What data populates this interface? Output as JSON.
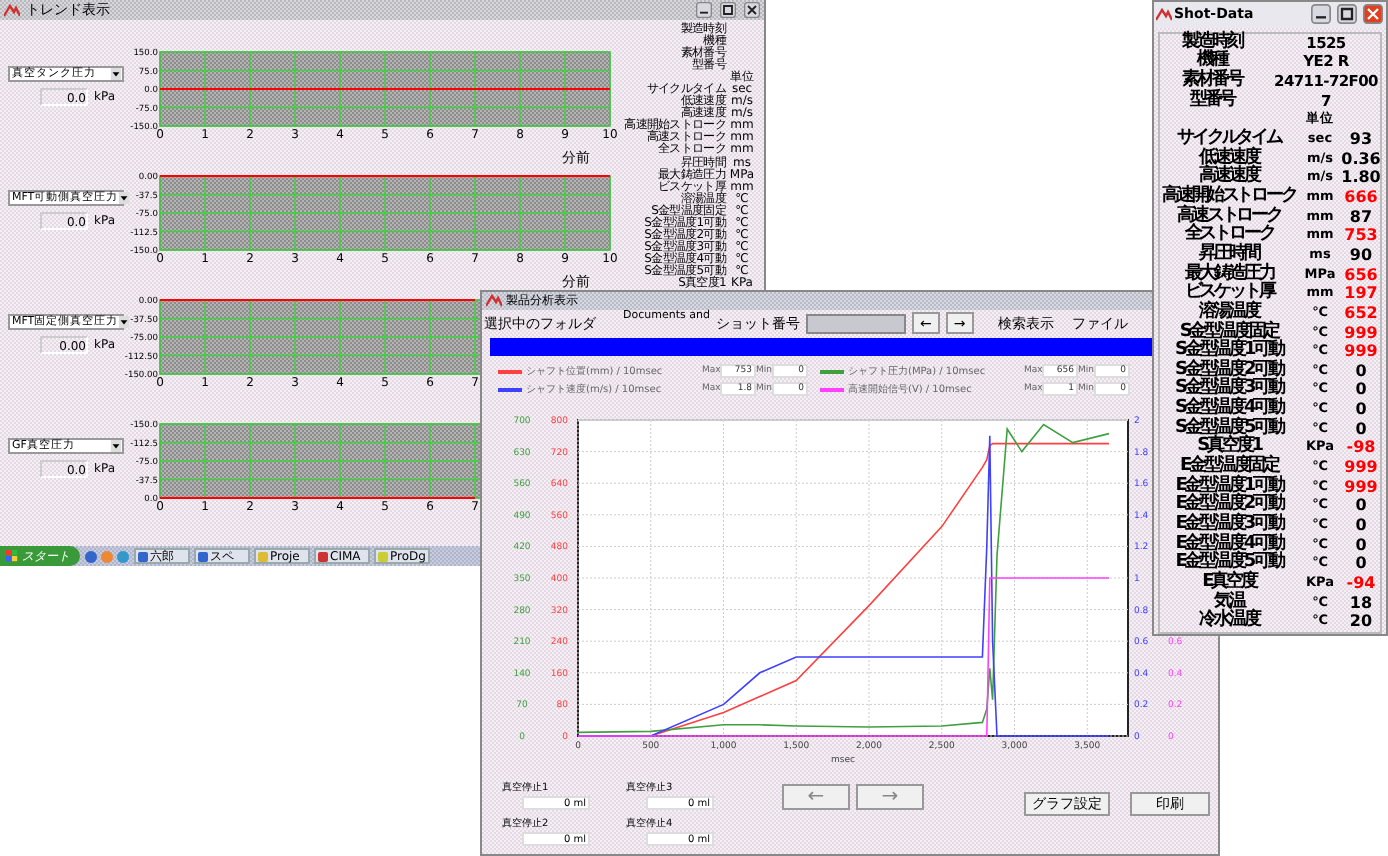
{
  "trend_window": {
    "title": "トレンド表示",
    "charts": [
      {
        "sensor": "真空タンク圧力",
        "value": "0.0",
        "unit": "kPa",
        "axis_caption": "分前",
        "chart_data": {
          "type": "line",
          "grid": true,
          "x": [
            0,
            10
          ],
          "xlim": [
            0,
            10
          ],
          "ylim": [
            -150,
            150
          ],
          "xticks": [
            0,
            1,
            2,
            3,
            4,
            5,
            6,
            7,
            8,
            9,
            10
          ],
          "yticks": [
            {
              "value": 150,
              "label": "150.0"
            },
            {
              "value": 75,
              "label": "75.0"
            },
            {
              "value": 0,
              "label": "0.0"
            },
            {
              "value": -75,
              "label": "-75.0"
            },
            {
              "value": -150,
              "label": "-150.0"
            }
          ],
          "series": [
            {
              "color": "#ff0000",
              "values": [
                0,
                0
              ]
            }
          ]
        }
      },
      {
        "sensor": "MFT可動側真空圧力",
        "value": "0.0",
        "unit": "kPa",
        "axis_caption": "分前",
        "chart_data": {
          "type": "line",
          "grid": true,
          "x": [
            0,
            10
          ],
          "xlim": [
            0,
            10
          ],
          "ylim": [
            -150,
            0
          ],
          "xticks": [
            0,
            1,
            2,
            3,
            4,
            5,
            6,
            7,
            8,
            9,
            10
          ],
          "yticks": [
            {
              "value": 0,
              "label": "0.00"
            },
            {
              "value": -37.5,
              "label": "-37.5"
            },
            {
              "value": -75,
              "label": "-75.0"
            },
            {
              "value": -112.5,
              "label": "-112.5"
            },
            {
              "value": -150,
              "label": "-150.0"
            }
          ],
          "series": [
            {
              "color": "#ff0000",
              "values": [
                0,
                0
              ]
            }
          ]
        }
      },
      {
        "sensor": "MFT固定側真空圧力",
        "value": "0.00",
        "unit": "kPa",
        "chart_data": {
          "type": "line",
          "grid": true,
          "x": [
            0,
            7
          ],
          "xlim": [
            0,
            10
          ],
          "ylim": [
            -150,
            0
          ],
          "xticks": [
            0,
            1,
            2,
            3,
            4,
            5,
            6,
            7
          ],
          "yticks": [
            {
              "value": 0,
              "label": "0.00"
            },
            {
              "value": -37.5,
              "label": "-37.50"
            },
            {
              "value": -75,
              "label": "-75.00"
            },
            {
              "value": -112.5,
              "label": "-112.50"
            },
            {
              "value": -150,
              "label": "-150.00"
            }
          ],
          "series": [
            {
              "color": "#ff0000",
              "values": [
                0,
                0
              ]
            }
          ]
        }
      },
      {
        "sensor": "GF真空圧力",
        "value": "0.0",
        "unit": "kPa",
        "chart_data": {
          "type": "line",
          "grid": true,
          "x": [
            0,
            7
          ],
          "xlim": [
            0,
            10
          ],
          "ylim": [
            0,
            -150
          ],
          "xticks": [
            0,
            1,
            2,
            3,
            4,
            5,
            6,
            7
          ],
          "yticks": [
            {
              "value": -150,
              "label": "-150.0"
            },
            {
              "value": -112.5,
              "label": "-112.5"
            },
            {
              "value": -75,
              "label": "-75.0"
            },
            {
              "value": -37.5,
              "label": "-37.5"
            },
            {
              "value": 0,
              "label": "0.0"
            }
          ],
          "series": [
            {
              "color": "#ff0000",
              "values": [
                0,
                0
              ]
            }
          ]
        }
      }
    ],
    "summary_items": [
      {
        "label": "製造時刻"
      },
      {
        "label": "機種"
      },
      {
        "label": "素材番号"
      },
      {
        "label": "型番号"
      },
      {
        "unit": "単位"
      },
      {
        "label": "サイクルタイム",
        "unit": "sec"
      },
      {
        "label": "低速速度",
        "unit": "m/s"
      },
      {
        "label": "高速速度",
        "unit": "m/s"
      },
      {
        "label": "高速開始ストローク",
        "unit": "mm"
      },
      {
        "label": "高速ストローク",
        "unit": "mm"
      },
      {
        "label": "全ストローク",
        "unit": "mm"
      },
      {
        "label": "昇圧時間",
        "unit": "ms"
      },
      {
        "label": "最大鋳造圧力",
        "unit": "MPa"
      },
      {
        "label": "ビスケット厚",
        "unit": "mm"
      },
      {
        "label": "溶湯温度",
        "unit": "℃"
      },
      {
        "label": "S金型温度固定",
        "unit": "℃"
      },
      {
        "label": "S金型温度1可動",
        "unit": "℃"
      },
      {
        "label": "S金型温度2可動",
        "unit": "℃"
      },
      {
        "label": "S金型温度3可動",
        "unit": "℃"
      },
      {
        "label": "S金型温度4可動",
        "unit": "℃"
      },
      {
        "label": "S金型温度5可動",
        "unit": "℃"
      },
      {
        "label": "S真空度1",
        "unit": "KPa"
      }
    ]
  },
  "taskbar": {
    "start": "スタート",
    "tasks": [
      "六郎",
      "スペ",
      "Proje",
      "CIMA",
      "ProDg"
    ]
  },
  "analysis_window": {
    "title": "製品分析表示",
    "progress": {
      "level": 1
    },
    "folder_label": "選択中のフォルダ",
    "folder_path": "Documents and",
    "shot_label": "ショット番号",
    "prev": "←",
    "next": "→",
    "search": "検索表示",
    "file": "ファイル",
    "legend": [
      {
        "name": "シャフト位置(mm) / 10msec",
        "color": "#ff4040",
        "max_label": "Max",
        "max": "753",
        "min_label": "Min",
        "min": "0"
      },
      {
        "name": "シャフト圧力(MPa) / 10msec",
        "color": "#40a040",
        "max_label": "Max",
        "max": "656",
        "min_label": "Min",
        "min": "0"
      },
      {
        "name": "シャフト速度(m/s) / 10msec",
        "color": "#4040ff",
        "max_label": "Max",
        "max": "1.8",
        "min_label": "Min",
        "min": "0"
      },
      {
        "name": "高速開始信号(V) / 10msec",
        "color": "#ff40ff",
        "max_label": "Max",
        "max": "1",
        "min_label": "Min",
        "min": "0"
      }
    ],
    "charts": [
      {
        "chart_data": {
          "type": "line",
          "grid": true,
          "xlabel": "msec",
          "xlim": [
            0,
            3780
          ],
          "ylim": [
            0,
            800
          ],
          "x": [
            0,
            500,
            1000,
            1250,
            1500,
            2000,
            2500,
            2780,
            2810,
            2830,
            2850,
            2880,
            2950,
            3050,
            3200,
            3400,
            3650
          ],
          "xticks": [
            {
              "value": 0,
              "label": "0"
            },
            {
              "value": 500,
              "label": "500"
            },
            {
              "value": 1000,
              "label": "1,000"
            },
            {
              "value": 1500,
              "label": "1,500"
            },
            {
              "value": 2000,
              "label": "2,000"
            },
            {
              "value": 2500,
              "label": "2,500"
            },
            {
              "value": 3000,
              "label": "3,000"
            },
            {
              "value": 3500,
              "label": "3,500"
            }
          ],
          "yticks": [
            0,
            80,
            160,
            240,
            320,
            400,
            480,
            560,
            640,
            720,
            800
          ],
          "series": [
            {
              "color": "#ff4040",
              "values": [
                0,
                0,
                60,
                100,
                140,
                330,
                530,
                680,
                700,
                735,
                740,
                740,
                740,
                740,
                740,
                740,
                740
              ]
            }
          ]
        }
      },
      {
        "chart_data": {
          "type": "line",
          "xlim": [
            0,
            3780
          ],
          "ylim": [
            0,
            700
          ],
          "x": [
            0,
            500,
            1000,
            1250,
            1500,
            2000,
            2500,
            2780,
            2810,
            2830,
            2850,
            2880,
            2950,
            3050,
            3200,
            3400,
            3650
          ],
          "yticks": [
            0,
            70,
            140,
            210,
            280,
            350,
            420,
            490,
            560,
            630,
            700
          ],
          "series": [
            {
              "color": "#40a040",
              "values": [
                8,
                10,
                25,
                25,
                22,
                20,
                22,
                30,
                60,
                150,
                80,
                400,
                680,
                630,
                690,
                650,
                670
              ]
            }
          ]
        }
      },
      {
        "chart_data": {
          "type": "line",
          "xlim": [
            0,
            3780
          ],
          "ylim": [
            0,
            2
          ],
          "x": [
            0,
            500,
            1000,
            1250,
            1500,
            2000,
            2500,
            2780,
            2810,
            2830,
            2850,
            2880,
            2950,
            3050,
            3200,
            3400,
            3650
          ],
          "yticks": [
            0,
            0.2,
            0.4,
            0.6,
            0.8,
            1,
            1.2,
            1.4,
            1.6,
            1.8,
            2
          ],
          "series": [
            {
              "color": "#4040ff",
              "values": [
                0,
                0,
                0.2,
                0.4,
                0.5,
                0.5,
                0.5,
                0.5,
                1.2,
                1.9,
                0.6,
                0,
                0,
                0,
                0,
                0,
                0
              ]
            }
          ]
        }
      },
      {
        "chart_data": {
          "type": "line",
          "xlim": [
            0,
            3780
          ],
          "ylim": [
            0,
            2
          ],
          "x": [
            0,
            500,
            1000,
            1250,
            1500,
            2000,
            2500,
            2780,
            2810,
            2830,
            2850,
            2880,
            2950,
            3050,
            3200,
            3400,
            3650
          ],
          "yticks": [
            0,
            0.2,
            0.4,
            0.6
          ],
          "series": [
            {
              "color": "#ff40ff",
              "values": [
                0,
                0,
                0,
                0,
                0,
                0,
                0,
                0,
                0,
                1,
                1,
                1,
                1,
                1,
                1,
                1,
                1
              ]
            }
          ]
        }
      }
    ],
    "stops": [
      {
        "label": "真空停止1",
        "value": "0",
        "unit": "ml"
      },
      {
        "label": "真空停止3",
        "value": "0",
        "unit": "ml"
      },
      {
        "label": "真空停止2",
        "value": "0",
        "unit": "ml"
      },
      {
        "label": "真空停止4",
        "value": "0",
        "unit": "ml"
      }
    ],
    "back": "←",
    "forward": "→",
    "graph_settings": "グラフ設定",
    "print": "印刷"
  },
  "shot_window": {
    "title": "Shot-Data",
    "header": [
      {
        "label": "製造時刻",
        "value": "1525"
      },
      {
        "label": "機種",
        "value": "YE2 R"
      },
      {
        "label": "素材番号",
        "value": "24711-72F00"
      },
      {
        "label": "型番号",
        "value": "7"
      }
    ],
    "unit_heading": "単位",
    "rows": [
      {
        "label": "サイクルタイム",
        "unit": "sec",
        "value": "93",
        "alert": false
      },
      {
        "label": "低速速度",
        "unit": "m/s",
        "value": "0.36",
        "alert": false
      },
      {
        "label": "高速速度",
        "unit": "m/s",
        "value": "1.80",
        "alert": false
      },
      {
        "label": "高速開始ストローク",
        "unit": "mm",
        "value": "666",
        "alert": true
      },
      {
        "label": "高速ストローク",
        "unit": "mm",
        "value": "87",
        "alert": false
      },
      {
        "label": "全ストローク",
        "unit": "mm",
        "value": "753",
        "alert": true
      },
      {
        "label": "昇圧時間",
        "unit": "ms",
        "value": "90",
        "alert": false
      },
      {
        "label": "最大鋳造圧力",
        "unit": "MPa",
        "value": "656",
        "alert": true
      },
      {
        "label": "ビスケット厚",
        "unit": "mm",
        "value": "197",
        "alert": true
      },
      {
        "label": "溶湯温度",
        "unit": "℃",
        "value": "652",
        "alert": true
      },
      {
        "label": "S金型温度固定",
        "unit": "℃",
        "value": "999",
        "alert": true
      },
      {
        "label": "S金型温度1可動",
        "unit": "℃",
        "value": "999",
        "alert": true
      },
      {
        "label": "S金型温度2可動",
        "unit": "℃",
        "value": "0",
        "alert": false
      },
      {
        "label": "S金型温度3可動",
        "unit": "℃",
        "value": "0",
        "alert": false
      },
      {
        "label": "S金型温度4可動",
        "unit": "℃",
        "value": "0",
        "alert": false
      },
      {
        "label": "S金型温度5可動",
        "unit": "℃",
        "value": "0",
        "alert": false
      },
      {
        "label": "S真空度1",
        "unit": "KPa",
        "value": "-98",
        "alert": true
      },
      {
        "label": "E金型温度固定",
        "unit": "℃",
        "value": "999",
        "alert": true
      },
      {
        "label": "E金型温度1可動",
        "unit": "℃",
        "value": "999",
        "alert": true
      },
      {
        "label": "E金型温度2可動",
        "unit": "℃",
        "value": "0",
        "alert": false
      },
      {
        "label": "E金型温度3可動",
        "unit": "℃",
        "value": "0",
        "alert": false
      },
      {
        "label": "E金型温度4可動",
        "unit": "℃",
        "value": "0",
        "alert": false
      },
      {
        "label": "E金型温度5可動",
        "unit": "℃",
        "value": "0",
        "alert": false
      },
      {
        "label": "E真空度",
        "unit": "KPa",
        "value": "-94",
        "alert": true
      },
      {
        "label": "気温",
        "unit": "℃",
        "value": "18",
        "alert": false
      },
      {
        "label": "冷水温度",
        "unit": "℃",
        "value": "20",
        "alert": false
      }
    ]
  }
}
